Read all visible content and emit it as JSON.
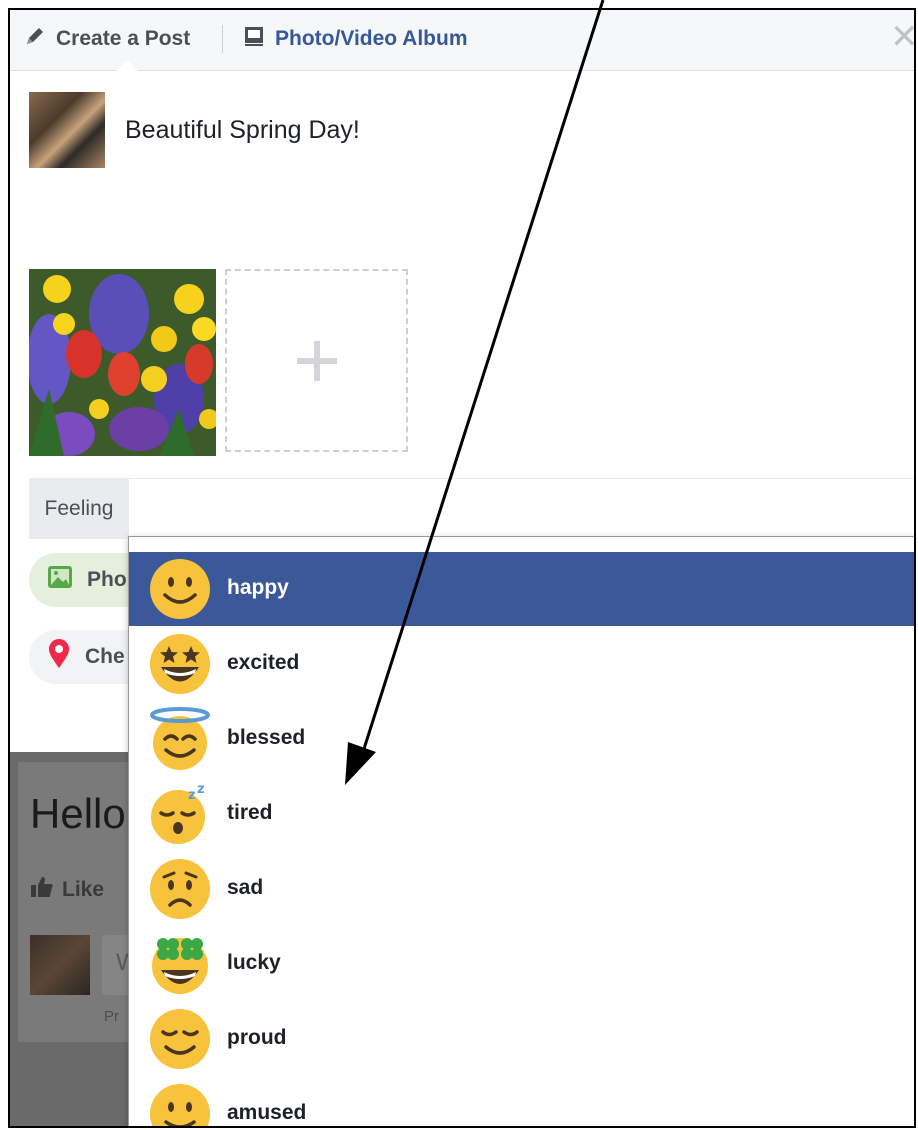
{
  "header": {
    "create_tab_label": "Create a Post",
    "photo_tab_label": "Photo/Video Album",
    "close_icon": "close-icon",
    "pencil_icon": "pencil-icon",
    "album_icon": "album-icon"
  },
  "composer": {
    "post_text": "Beautiful Spring Day!",
    "feeling_label": "Feeling",
    "photo_button_label": "Pho",
    "checkin_button_label": "Che"
  },
  "background_feed": {
    "post_text": "Hello",
    "like_label": "Like",
    "comment_placeholder": "W",
    "hint_text": "Pr"
  },
  "feelings": {
    "selected_index": 0,
    "options": [
      {
        "label": "happy",
        "icon": "happy-emoji-icon"
      },
      {
        "label": "excited",
        "icon": "excited-emoji-icon"
      },
      {
        "label": "blessed",
        "icon": "blessed-emoji-icon"
      },
      {
        "label": "tired",
        "icon": "tired-emoji-icon"
      },
      {
        "label": "sad",
        "icon": "sad-emoji-icon"
      },
      {
        "label": "lucky",
        "icon": "lucky-emoji-icon"
      },
      {
        "label": "proud",
        "icon": "proud-emoji-icon"
      },
      {
        "label": "amused",
        "icon": "amused-emoji-icon"
      }
    ]
  },
  "colors": {
    "selected_background": "#3b5998",
    "link_blue": "#365899",
    "emoji_yellow": "#f7c23c",
    "photo_pill_green": "#e4f0dc",
    "checkin_pin_pink": "#f0284a"
  }
}
